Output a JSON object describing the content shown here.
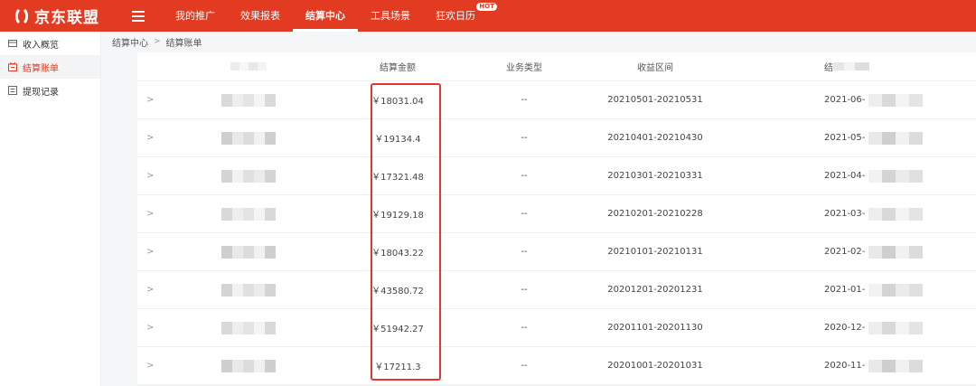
{
  "brand": {
    "name": "京东联盟",
    "color": "#e23b22"
  },
  "nav": {
    "items": [
      {
        "label": "我的推广"
      },
      {
        "label": "效果报表"
      },
      {
        "label": "结算中心",
        "active": true
      },
      {
        "label": "工具场景"
      },
      {
        "label": "狂欢日历",
        "badge": "HOT"
      }
    ]
  },
  "sidebar": {
    "items": [
      {
        "label": "收入概览",
        "icon": "wallet-icon"
      },
      {
        "label": "结算账单",
        "icon": "bill-icon",
        "active": true
      },
      {
        "label": "提现记录",
        "icon": "record-icon"
      }
    ]
  },
  "breadcrumb": {
    "parent": "结算中心",
    "current": "结算账单"
  },
  "table": {
    "headers": [
      "",
      "结算金额",
      "业务类型",
      "收益区间",
      "结"
    ],
    "rows": [
      {
        "amount": "￥18031.04",
        "type": "--",
        "period": "20210501-20210531",
        "date": "2021-06-"
      },
      {
        "amount": "￥19134.4",
        "type": "--",
        "period": "20210401-20210430",
        "date": "2021-05-"
      },
      {
        "amount": "￥17321.48",
        "type": "--",
        "period": "20210301-20210331",
        "date": "2021-04-"
      },
      {
        "amount": "￥19129.18",
        "type": "--",
        "period": "20210201-20210228",
        "date": "2021-03-"
      },
      {
        "amount": "￥18043.22",
        "type": "--",
        "period": "20210101-20210131",
        "date": "2021-02-"
      },
      {
        "amount": "￥43580.72",
        "type": "--",
        "period": "20201201-20201231",
        "date": "2021-01-"
      },
      {
        "amount": "￥51942.27",
        "type": "--",
        "period": "20201101-20201130",
        "date": "2020-12-"
      },
      {
        "amount": "￥17211.3",
        "type": "--",
        "period": "20201001-20201031",
        "date": "2020-11-"
      }
    ]
  },
  "colors": {
    "highlight_box": "#e5352c"
  }
}
